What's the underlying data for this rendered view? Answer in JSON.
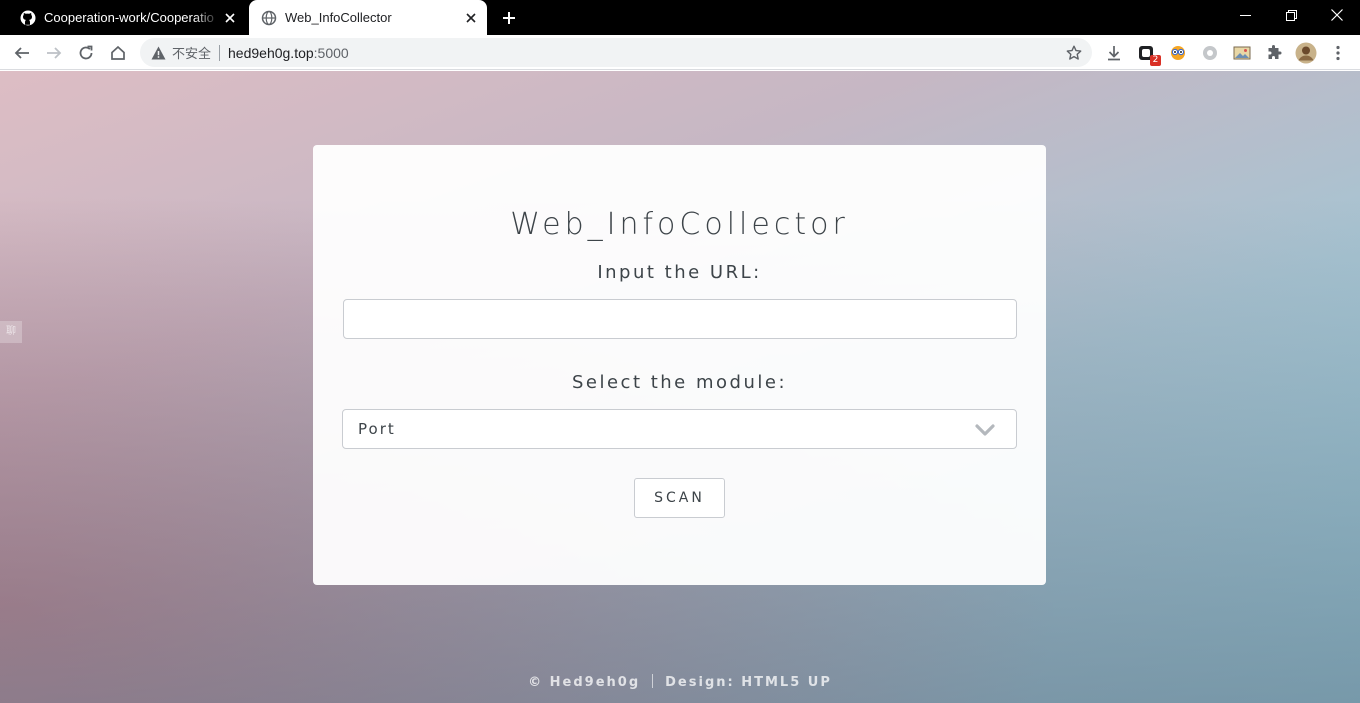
{
  "browser": {
    "tabs": [
      {
        "title": "Cooperation-work/Cooperatio",
        "favicon": "github-icon",
        "active": false
      },
      {
        "title": "Web_InfoCollector",
        "favicon": "globe-icon",
        "active": true
      }
    ],
    "address_bar": {
      "security_label": "不安全",
      "host": "hed9eh0g.top",
      "port": ":5000"
    },
    "extensions": [
      {
        "icon": "extension-badge-icon",
        "badge": "2"
      },
      {
        "icon": "extension-eyes-icon"
      },
      {
        "icon": "extension-gray-icon"
      },
      {
        "icon": "extension-image-icon"
      },
      {
        "icon": "puzzle-icon"
      },
      {
        "icon": "profile-avatar"
      }
    ]
  },
  "page": {
    "side_tab_text": "聊",
    "title": "Web_InfoCollector",
    "url_label": "Input the URL:",
    "url_value": "",
    "module_label": "Select the module:",
    "module_selected": "Port",
    "scan_button": "SCAN",
    "footer": {
      "copyright": "© Hed9eh0g",
      "design": "Design: HTML5 UP"
    }
  }
}
